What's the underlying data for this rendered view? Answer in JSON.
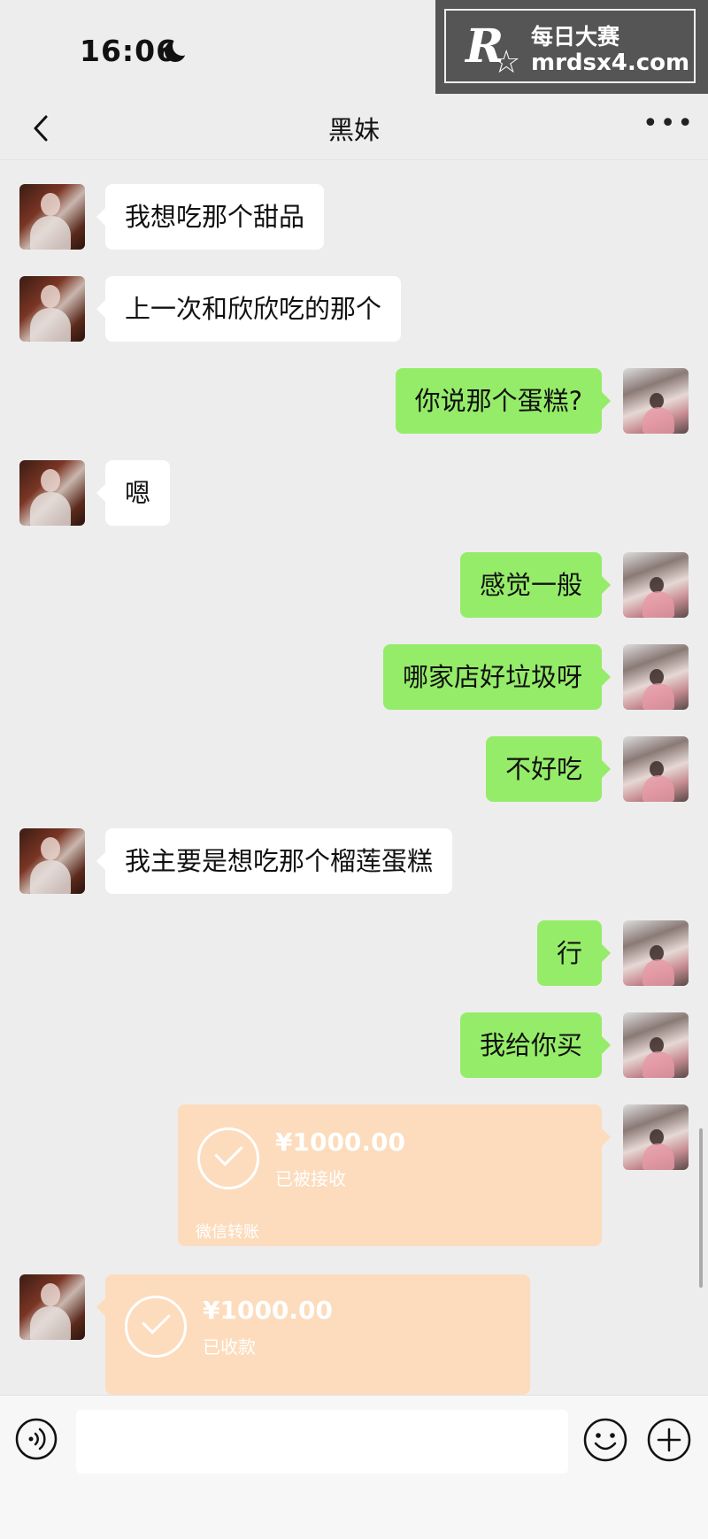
{
  "status_bar": {
    "time": "16:06"
  },
  "watermark": {
    "logo": "R",
    "name_cn": "每日大赛",
    "url": "mrdsx4.com"
  },
  "nav": {
    "title": "黑妹"
  },
  "messages": [
    {
      "side": "in",
      "text": "我想吃那个甜品"
    },
    {
      "side": "in",
      "text": "上一次和欣欣吃的那个"
    },
    {
      "side": "out",
      "text": "你说那个蛋糕?"
    },
    {
      "side": "in",
      "text": "嗯"
    },
    {
      "side": "out",
      "text": "感觉一般"
    },
    {
      "side": "out",
      "text": "哪家店好垃圾呀"
    },
    {
      "side": "out",
      "text": "不好吃"
    },
    {
      "side": "in",
      "text": "我主要是想吃那个榴莲蛋糕"
    },
    {
      "side": "out",
      "text": "行"
    },
    {
      "side": "out",
      "text": "我给你买"
    }
  ],
  "transfers": [
    {
      "side": "out",
      "amount": "¥1000.00",
      "status": "已被接收",
      "footer": "微信转账"
    },
    {
      "side": "in",
      "amount": "¥1000.00",
      "status": "已收款"
    }
  ],
  "input": {
    "placeholder": ""
  },
  "colors": {
    "outgoing_bubble": "#95ec69",
    "incoming_bubble": "#ffffff",
    "transfer": "#fcdcbd",
    "background": "#ededed"
  }
}
